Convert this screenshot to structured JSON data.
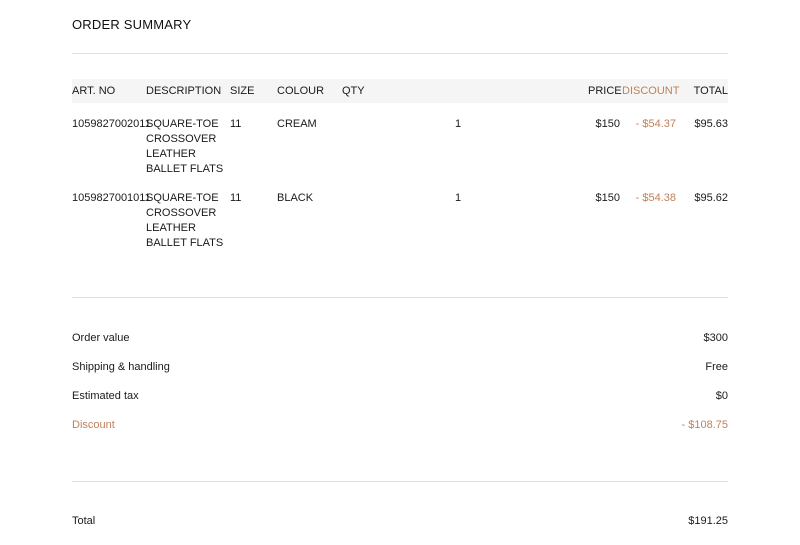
{
  "title": "ORDER SUMMARY",
  "columns": {
    "art_no": "ART. NO",
    "description": "DESCRIPTION",
    "size": "SIZE",
    "colour": "COLOUR",
    "qty": "QTY",
    "price": "PRICE",
    "discount": "DISCOUNT",
    "total": "TOTAL"
  },
  "items": [
    {
      "art_no": "1059827002011",
      "description": "SQUARE-TOE CROSSOVER LEATHER BALLET FLATS",
      "size": "11",
      "colour": "CREAM",
      "qty": "1",
      "price": "$150",
      "discount": "- $54.37",
      "total": "$95.63"
    },
    {
      "art_no": "1059827001011",
      "description": "SQUARE-TOE CROSSOVER LEATHER BALLET FLATS",
      "size": "11",
      "colour": "BLACK",
      "qty": "1",
      "price": "$150",
      "discount": "- $54.38",
      "total": "$95.62"
    }
  ],
  "summary": {
    "order_value_label": "Order value",
    "order_value": "$300",
    "shipping_label": "Shipping & handling",
    "shipping": "Free",
    "tax_label": "Estimated tax",
    "tax": "$0",
    "discount_label": "Discount",
    "discount": "- $108.75",
    "total_label": "Total",
    "total": "$191.25"
  },
  "colors": {
    "discount": "#c0805a",
    "header_bg": "#f5f5f5",
    "divider": "#e2e2e2"
  }
}
